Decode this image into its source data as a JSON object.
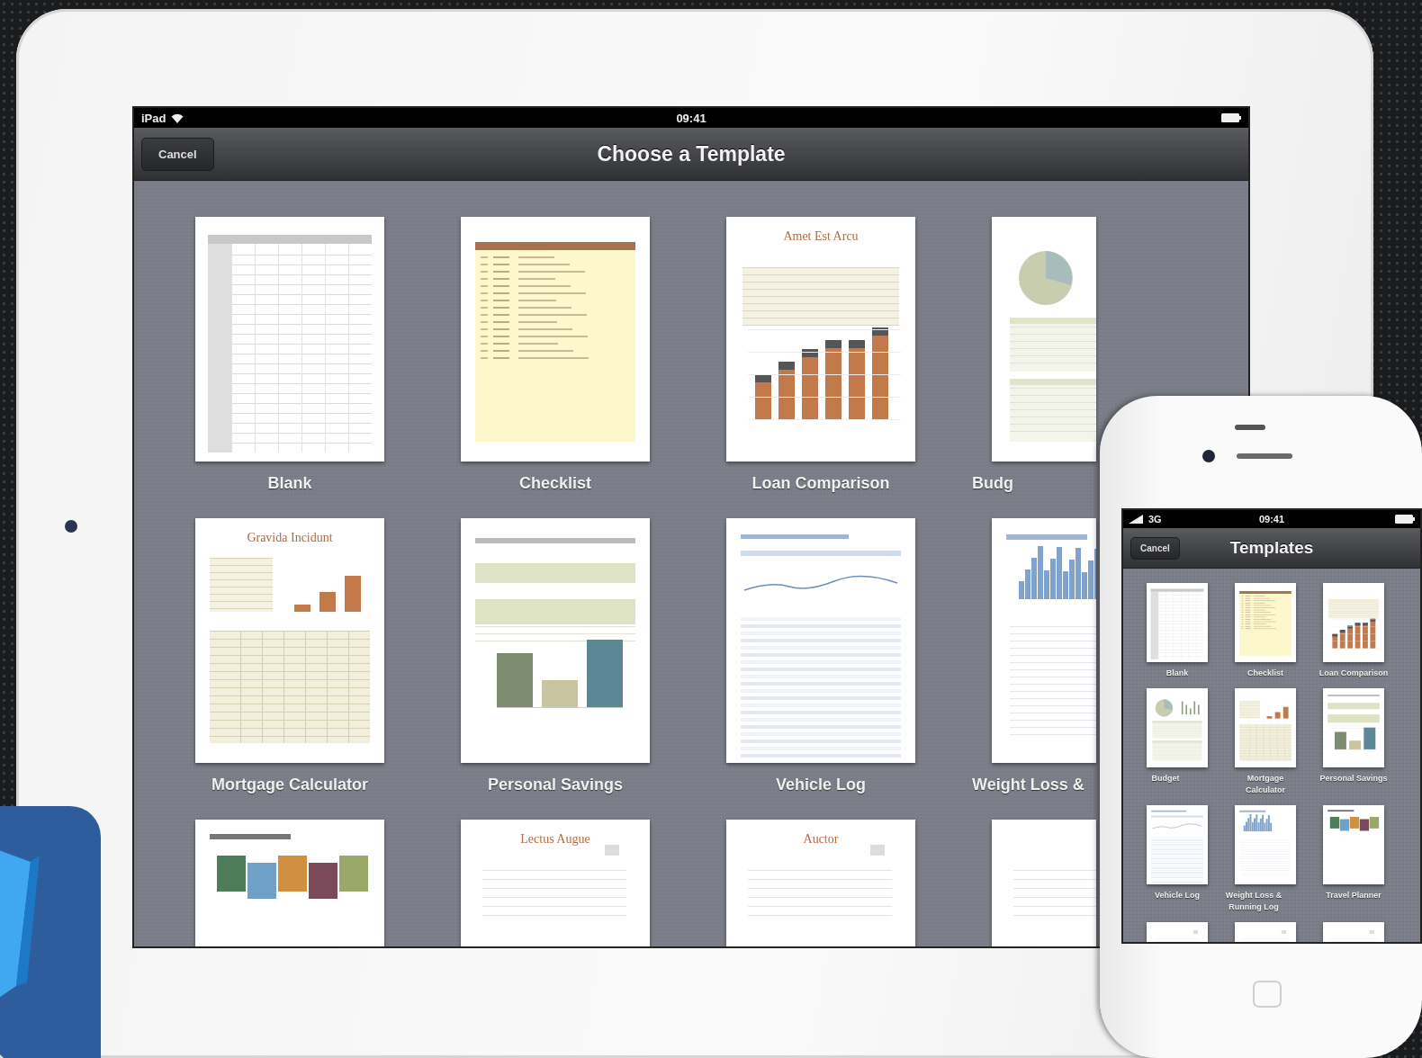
{
  "ipad": {
    "status_bar": {
      "device": "iPad",
      "time": "09:41"
    },
    "nav_bar": {
      "cancel_button": "Cancel",
      "title": "Choose a Template"
    },
    "templates": [
      {
        "label": "Blank",
        "kind": "blank"
      },
      {
        "label": "Checklist",
        "kind": "checklist"
      },
      {
        "label": "Loan Comparison",
        "kind": "bars",
        "doc_title": "Amet Est Arcu"
      },
      {
        "label": "Budg",
        "kind": "pie"
      },
      {
        "label": "Mortgage Calculator",
        "kind": "mortgage",
        "doc_title": "Gravida Incidunt"
      },
      {
        "label": "Personal Savings",
        "kind": "savings"
      },
      {
        "label": "Vehicle Log",
        "kind": "log"
      },
      {
        "label": "Weight Loss &",
        "kind": "area"
      },
      {
        "kind": "photos"
      },
      {
        "kind": "form",
        "doc_title": "Lectus Augue"
      },
      {
        "kind": "form",
        "doc_title": "Auctor"
      },
      {
        "kind": "form"
      }
    ]
  },
  "iphone": {
    "status_bar": {
      "network": "3G",
      "time": "09:41"
    },
    "nav_bar": {
      "cancel_button": "Cancel",
      "title": "Templates"
    },
    "templates": [
      {
        "label": "Blank",
        "kind": "blank"
      },
      {
        "label": "Checklist",
        "kind": "checklist"
      },
      {
        "label": "Loan Comparison",
        "kind": "bars"
      },
      {
        "label": "Budget",
        "kind": "pie"
      },
      {
        "label": "Mortgage Calculator",
        "kind": "mortgage"
      },
      {
        "label": "Personal Savings",
        "kind": "savings"
      },
      {
        "label": "Vehicle Log",
        "kind": "log"
      },
      {
        "label": "Weight Loss & Running Log",
        "kind": "area"
      },
      {
        "label": "Travel Planner",
        "kind": "photos"
      },
      {
        "kind": "form"
      },
      {
        "kind": "form"
      },
      {
        "kind": "form"
      }
    ]
  }
}
